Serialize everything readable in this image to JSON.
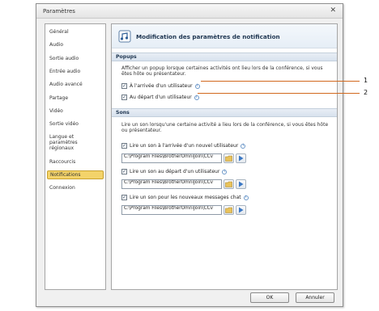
{
  "window": {
    "title": "Paramètres",
    "close_glyph": "✕",
    "ok_label": "OK",
    "cancel_label": "Annuler"
  },
  "sidebar": {
    "items": [
      {
        "label": "Général"
      },
      {
        "label": "Audio"
      },
      {
        "label": "Sortie audio"
      },
      {
        "label": "Entrée audio"
      },
      {
        "label": "Audio avancé"
      },
      {
        "label": "Partage"
      },
      {
        "label": "Vidéo"
      },
      {
        "label": "Sortie vidéo"
      },
      {
        "label": "Langue et paramètres régionaux"
      },
      {
        "label": "Raccourcis"
      },
      {
        "label": "Notifications",
        "active": true
      },
      {
        "label": "Connexion"
      }
    ]
  },
  "header": {
    "title": "Modification des paramètres de notification",
    "icon": "notification-settings-icon"
  },
  "popups": {
    "section_title": "Popups",
    "description": "Afficher un popup lorsque certaines activités ont lieu lors de la conférence, si vous êtes hôte ou présentateur.",
    "options": [
      {
        "label": "À l'arrivée d'un utilisateur",
        "checked": true
      },
      {
        "label": "Au départ d'un utilisateur",
        "checked": true
      }
    ]
  },
  "sons": {
    "section_title": "Sons",
    "description": "Lire un son lorsqu'une certaine activité a lieu lors de la conférence, si vous êtes hôte ou présentateur.",
    "options": [
      {
        "label": "Lire un son à l'arrivée d'un nouvel utilisateur",
        "checked": true,
        "path": "C:\\Program Files\\BrotherOmniJoin\\CCv"
      },
      {
        "label": "Lire un son au départ d'un utilisateur",
        "checked": true,
        "path": "C:\\Program Files\\BrotherOmniJoin\\CCv"
      },
      {
        "label": "Lire un son pour les nouveaux messages chat",
        "checked": true,
        "path": "C:\\Program Files\\BrotherOmniJoin\\CCv"
      }
    ]
  },
  "callouts": [
    "1",
    "2"
  ],
  "colors": {
    "active_item": "#f3d36a",
    "callout_line": "#d2691e",
    "play_icon": "#3b78c4",
    "section_text": "#1e3550"
  }
}
